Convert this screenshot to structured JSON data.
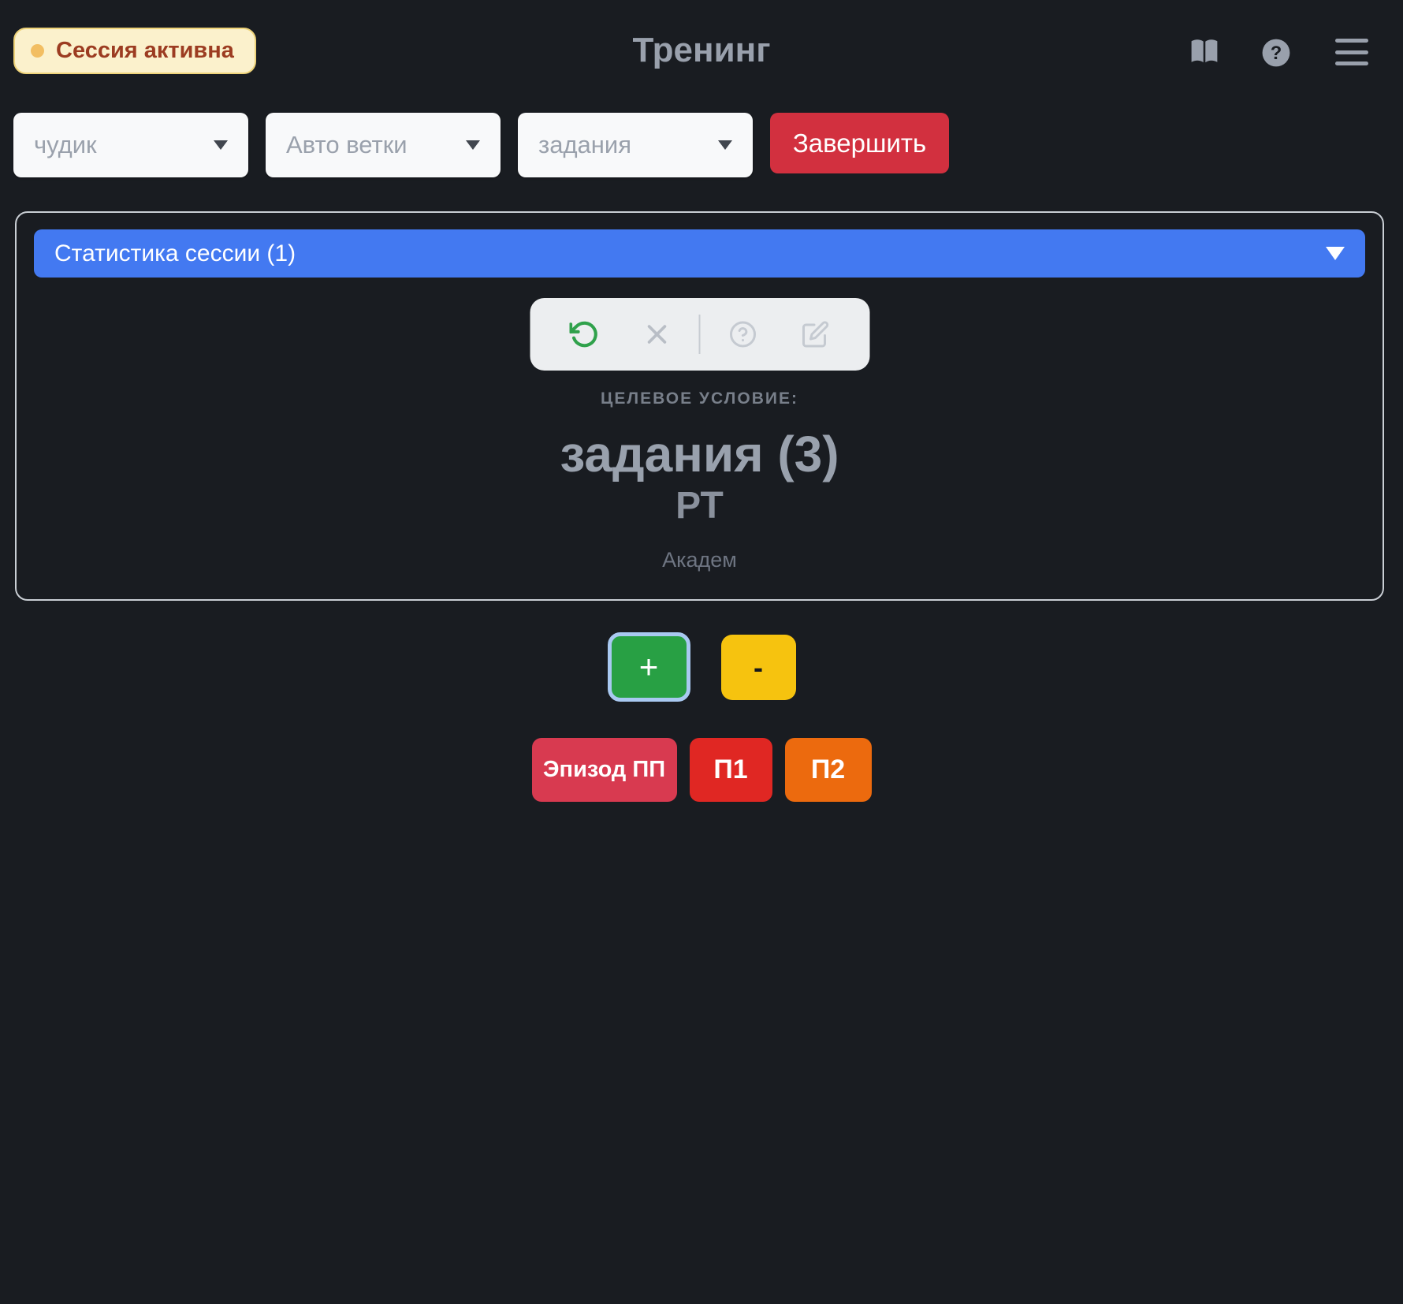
{
  "header": {
    "badge": {
      "label": "Сессия активна"
    },
    "title": "Тренинг",
    "icons": [
      "book",
      "help-circle",
      "menu"
    ]
  },
  "controls": {
    "selects": [
      {
        "value": "чудик"
      },
      {
        "value": "Авто ветки"
      },
      {
        "value": "задания"
      }
    ],
    "finish_button": "Завершить"
  },
  "stats_panel": {
    "header": "Статистика сессии (1)",
    "toolbar_icons": [
      "undo",
      "close",
      "help-circle",
      "edit"
    ],
    "goal": {
      "label": "ЦЕЛЕВОЕ УСЛОВИЕ:",
      "value": "задания (3)",
      "subtitle": "РТ",
      "note": "Академ"
    }
  },
  "counter": {
    "increment": "+",
    "decrement": "-"
  },
  "episode_buttons": [
    {
      "label": "Эпизод ПП",
      "color": "#d83a50"
    },
    {
      "label": "П1",
      "color": "#e02723"
    },
    {
      "label": "П2",
      "color": "#ec6a0e"
    }
  ],
  "colors": {
    "background": "#191c21",
    "badge_bg": "#fbf1cc",
    "badge_border": "#eed379",
    "badge_text": "#9c3c21",
    "badge_dot": "#f2be62",
    "title_text": "#99a0ac",
    "select_bg": "#f8f9fa",
    "select_text": "#9aa1ac",
    "finish_red": "#d2303f",
    "panel_border": "#c9ced4",
    "accent_blue": "#4379f1",
    "toolbar_bg": "#eceef0",
    "undo_green": "#2fa14b",
    "plus_green": "#28a044",
    "plus_ring": "#a9c9f1",
    "minus_yellow": "#f6c30f",
    "goal_text": "#99a1ad",
    "muted_text": "#6e7582"
  }
}
